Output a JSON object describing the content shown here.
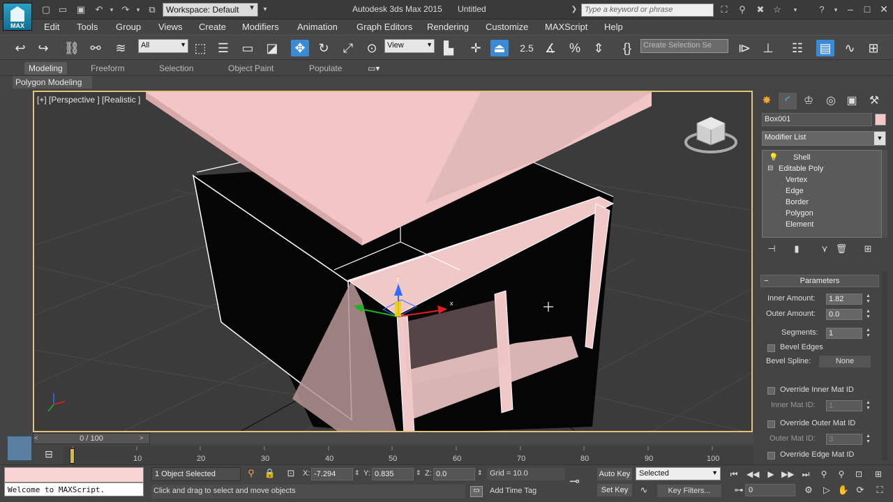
{
  "window": {
    "workspace": "Workspace: Default",
    "app_title": "Autodesk 3ds Max 2015",
    "doc_title": "Untitled",
    "search_placeholder": "Type a keyword or phrase",
    "logo_text": "MAX"
  },
  "menu": [
    "Edit",
    "Tools",
    "Group",
    "Views",
    "Create",
    "Modifiers",
    "Animation",
    "Graph Editors",
    "Rendering",
    "Customize",
    "MAXScript",
    "Help"
  ],
  "toolbar": {
    "filter_value": "All",
    "ref_coord_value": "View",
    "snap_angle_label": "2.5",
    "named_selection_placeholder": "Create Selection Se"
  },
  "ribbon": {
    "tabs": [
      "Modeling",
      "Freeform",
      "Selection",
      "Object Paint",
      "Populate"
    ],
    "panel_label": "Polygon Modeling"
  },
  "viewport": {
    "label": "[+] [Perspective ] [Realistic ]",
    "gizmo_axes": [
      "z",
      "x"
    ]
  },
  "command_panel": {
    "object_name": "Box001",
    "object_color": "#f3c8c8",
    "modifier_list": "Modifier List",
    "stack": {
      "modifier": "Shell",
      "base_object": "Editable Poly",
      "sub_objects": [
        "Vertex",
        "Edge",
        "Border",
        "Polygon",
        "Element"
      ]
    },
    "rollout_title": "Parameters",
    "params": {
      "inner_amount_label": "Inner Amount:",
      "inner_amount": "1.82",
      "outer_amount_label": "Outer Amount:",
      "outer_amount": "0.0",
      "segments_label": "Segments:",
      "segments": "1",
      "bevel_edges_label": "Bevel Edges",
      "bevel_spline_label": "Bevel Spline:",
      "bevel_spline_value": "None",
      "override_inner_label": "Override Inner Mat ID",
      "inner_mat_id_label": "Inner Mat ID:",
      "inner_mat_id": "1",
      "override_outer_label": "Override Outer Mat ID",
      "outer_mat_id_label": "Outer Mat ID:",
      "outer_mat_id": "3",
      "override_edge_label": "Override Edge Mat ID"
    }
  },
  "timeline": {
    "frame_display": "0 / 100",
    "ticks": [
      "10",
      "20",
      "30",
      "40",
      "50",
      "60",
      "70",
      "80",
      "90",
      "100"
    ]
  },
  "status": {
    "listener_text": "Welcome to MAXScript.",
    "selection_count": "1 Object Selected",
    "prompt": "Click and drag to select and move objects",
    "x_label": "X:",
    "x_value": "-7.294",
    "y_label": "Y:",
    "y_value": "0.835",
    "z_label": "Z:",
    "z_value": "0.0",
    "grid": "Grid = 10.0",
    "add_time_tag": "Add Time Tag",
    "auto_key": "Auto Key",
    "set_key": "Set Key",
    "key_mode_value": "Selected",
    "key_filters": "Key Filters...",
    "current_frame": "0"
  },
  "colors": {
    "accent": "#3b8ad6",
    "viewport_border": "#e2c37a",
    "object_pink": "#f3c8c8"
  }
}
